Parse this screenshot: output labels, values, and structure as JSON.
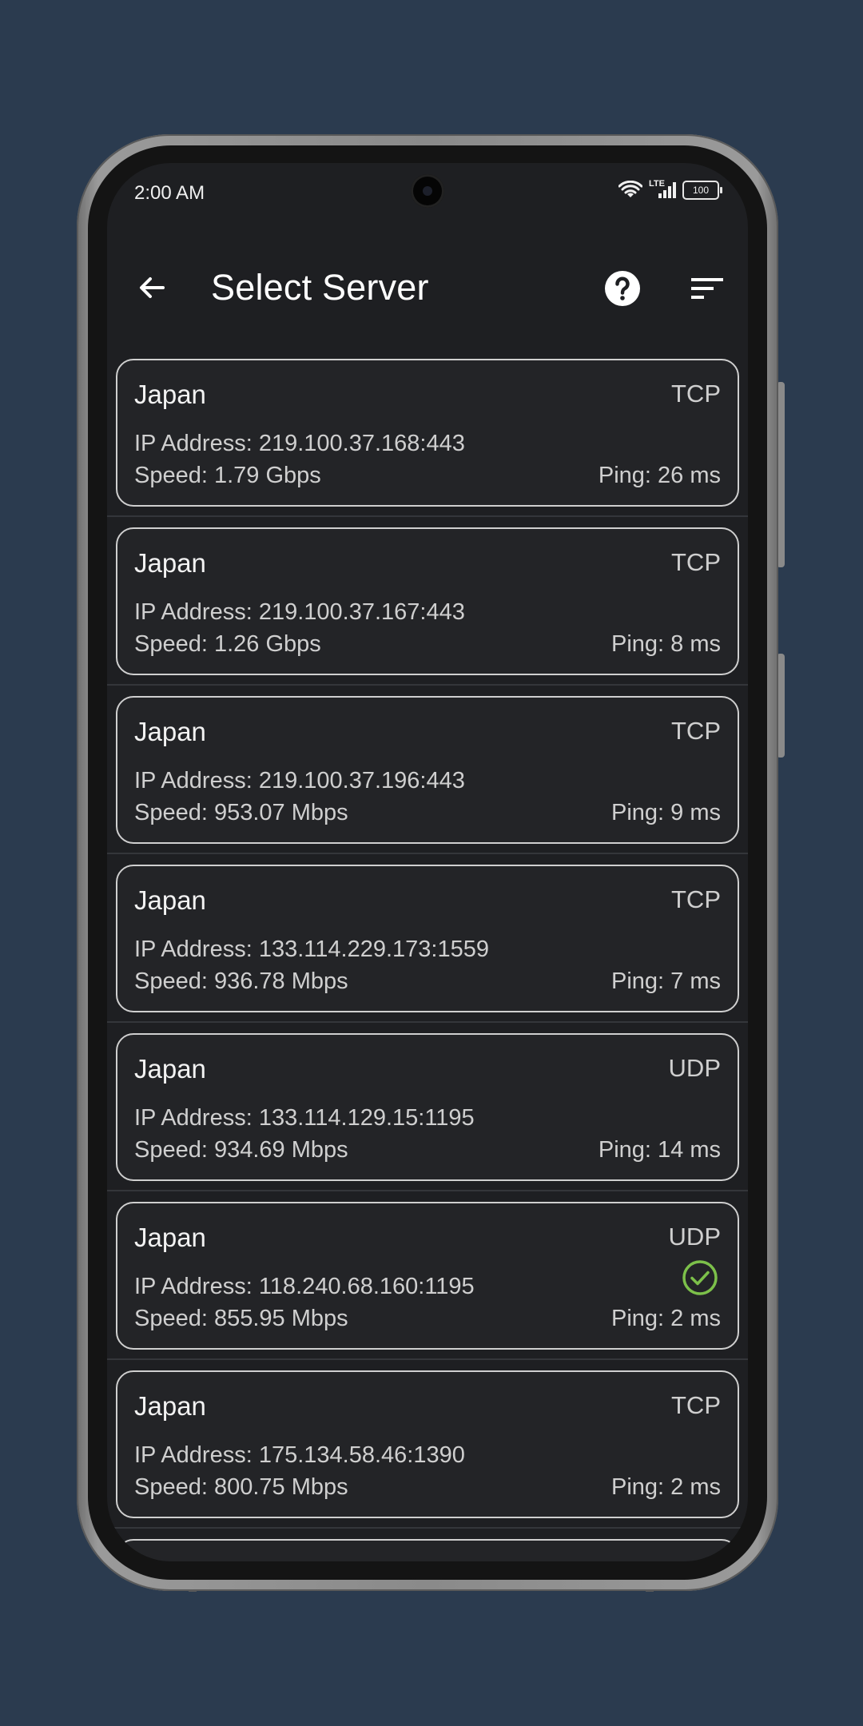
{
  "status_bar": {
    "time": "2:00 AM",
    "network": "LTE",
    "battery": "100"
  },
  "app_bar": {
    "title": "Select Server",
    "back_icon": "arrow-back-icon",
    "help_icon": "help-circle-icon",
    "sort_icon": "sort-icon"
  },
  "colors": {
    "background": "#2b3b4f",
    "screen": "#1e1f22",
    "card": "#232427",
    "card_border": "#cfcfcf",
    "selected_check": "#7cc04a"
  },
  "labels": {
    "ip_prefix": "IP Address: ",
    "speed_prefix": "Speed: ",
    "ping_prefix": "Ping: "
  },
  "servers": [
    {
      "country": "Japan",
      "protocol": "TCP",
      "ip": "IP Address: 219.100.37.168:443",
      "speed": "Speed: 1.79 Gbps",
      "ping": "Ping: 26 ms",
      "selected": false
    },
    {
      "country": "Japan",
      "protocol": "TCP",
      "ip": "IP Address: 219.100.37.167:443",
      "speed": "Speed: 1.26 Gbps",
      "ping": "Ping: 8 ms",
      "selected": false
    },
    {
      "country": "Japan",
      "protocol": "TCP",
      "ip": "IP Address: 219.100.37.196:443",
      "speed": "Speed: 953.07 Mbps",
      "ping": "Ping: 9 ms",
      "selected": false
    },
    {
      "country": "Japan",
      "protocol": "TCP",
      "ip": "IP Address: 133.114.229.173:1559",
      "speed": "Speed: 936.78 Mbps",
      "ping": "Ping: 7 ms",
      "selected": false
    },
    {
      "country": "Japan",
      "protocol": "UDP",
      "ip": "IP Address: 133.114.129.15:1195",
      "speed": "Speed: 934.69 Mbps",
      "ping": "Ping: 14 ms",
      "selected": false
    },
    {
      "country": "Japan",
      "protocol": "UDP",
      "ip": "IP Address: 118.240.68.160:1195",
      "speed": "Speed: 855.95 Mbps",
      "ping": "Ping: 2 ms",
      "selected": true
    },
    {
      "country": "Japan",
      "protocol": "TCP",
      "ip": "IP Address: 175.134.58.46:1390",
      "speed": "Speed: 800.75 Mbps",
      "ping": "Ping: 2 ms",
      "selected": false
    }
  ]
}
